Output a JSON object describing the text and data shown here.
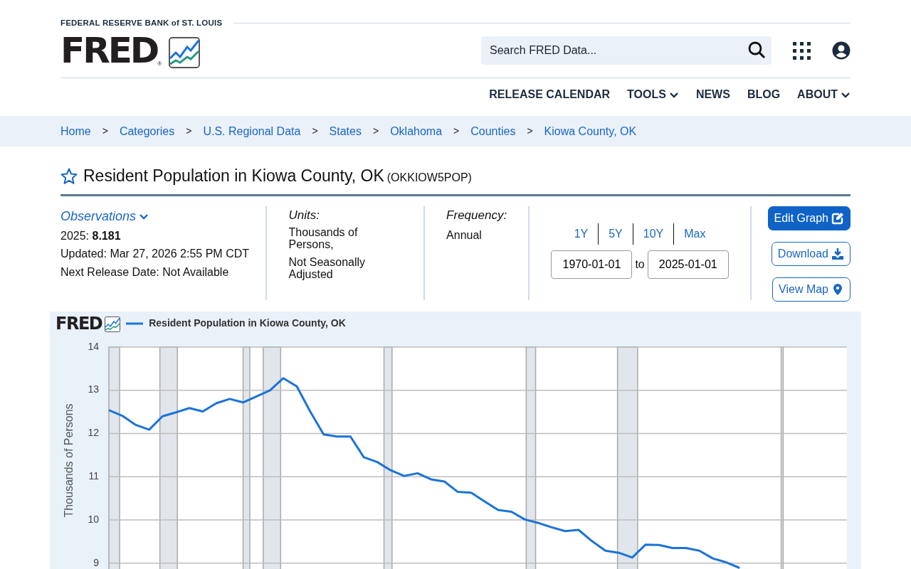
{
  "header": {
    "bank_name": "FEDERAL RESERVE BANK of ST. LOUIS",
    "logo_text": "FRED",
    "registered_mark": "®",
    "search": {
      "placeholder": "Search FRED Data..."
    }
  },
  "nav": [
    {
      "label": "RELEASE CALENDAR",
      "dropdown": false
    },
    {
      "label": "TOOLS",
      "dropdown": true
    },
    {
      "label": "NEWS",
      "dropdown": false
    },
    {
      "label": "BLOG",
      "dropdown": false
    },
    {
      "label": "ABOUT",
      "dropdown": true
    }
  ],
  "breadcrumbs": [
    "Home",
    "Categories",
    "U.S. Regional Data",
    "States",
    "Oklahoma",
    "Counties",
    "Kiowa County, OK"
  ],
  "breadcrumb_separator": ">",
  "series": {
    "title": "Resident Population in Kiowa County, OK",
    "id": "(OKKIOW5POP)",
    "favorite": false
  },
  "observations": {
    "heading": "Observations",
    "latest_label": "2025:",
    "latest_value": "8.181",
    "updated": "Updated: Mar 27, 2026 2:55 PM CDT",
    "next_release": "Next Release Date: Not Available"
  },
  "units": {
    "heading": "Units:",
    "lines": [
      "Thousands of Persons,",
      "Not Seasonally Adjusted"
    ]
  },
  "frequency": {
    "heading": "Frequency:",
    "value": "Annual"
  },
  "range": {
    "presets": [
      "1Y",
      "5Y",
      "10Y",
      "Max"
    ],
    "start": "1970-01-01",
    "separator": "to",
    "end": "2025-01-01"
  },
  "actions": [
    {
      "label": "Edit Graph",
      "kind": "primary"
    },
    {
      "label": "Download",
      "kind": "outline"
    },
    {
      "label": "View Map",
      "kind": "outline"
    }
  ],
  "graph": {
    "logo_text": "FRED",
    "chart_data": {
      "type": "line",
      "ylabel": "Thousands of Persons",
      "grid": true,
      "ylim": [
        8.75,
        14
      ],
      "yticks": [
        9,
        10,
        11,
        12,
        13,
        14
      ],
      "categories": [
        null,
        null,
        null,
        null,
        null,
        null,
        null,
        null,
        null,
        null,
        null,
        null,
        null,
        null,
        null,
        null,
        null,
        null,
        null,
        null,
        null,
        null,
        null,
        null,
        null,
        null,
        null,
        null,
        null,
        null,
        null,
        null,
        null,
        null,
        null,
        null,
        null,
        null,
        null,
        null,
        null,
        null,
        null,
        null,
        null,
        null,
        null,
        null
      ],
      "series": [
        {
          "name": "Resident Population in Kiowa County, OK",
          "color": "#1a73d9",
          "values": [
            12.54,
            12.41,
            12.2,
            12.09,
            12.4,
            12.49,
            12.59,
            12.51,
            12.7,
            12.8,
            12.72,
            12.86,
            13.0,
            13.28,
            13.09,
            12.51,
            11.98,
            11.93,
            11.93,
            11.45,
            11.34,
            11.15,
            11.02,
            11.08,
            10.94,
            10.89,
            10.65,
            10.63,
            10.43,
            10.23,
            10.19,
            10.01,
            9.93,
            9.83,
            9.74,
            9.77,
            9.51,
            9.29,
            9.24,
            9.13,
            9.43,
            9.42,
            9.35,
            9.35,
            9.29,
            9.11,
            9.02,
            8.89
          ]
        }
      ]
    }
  }
}
